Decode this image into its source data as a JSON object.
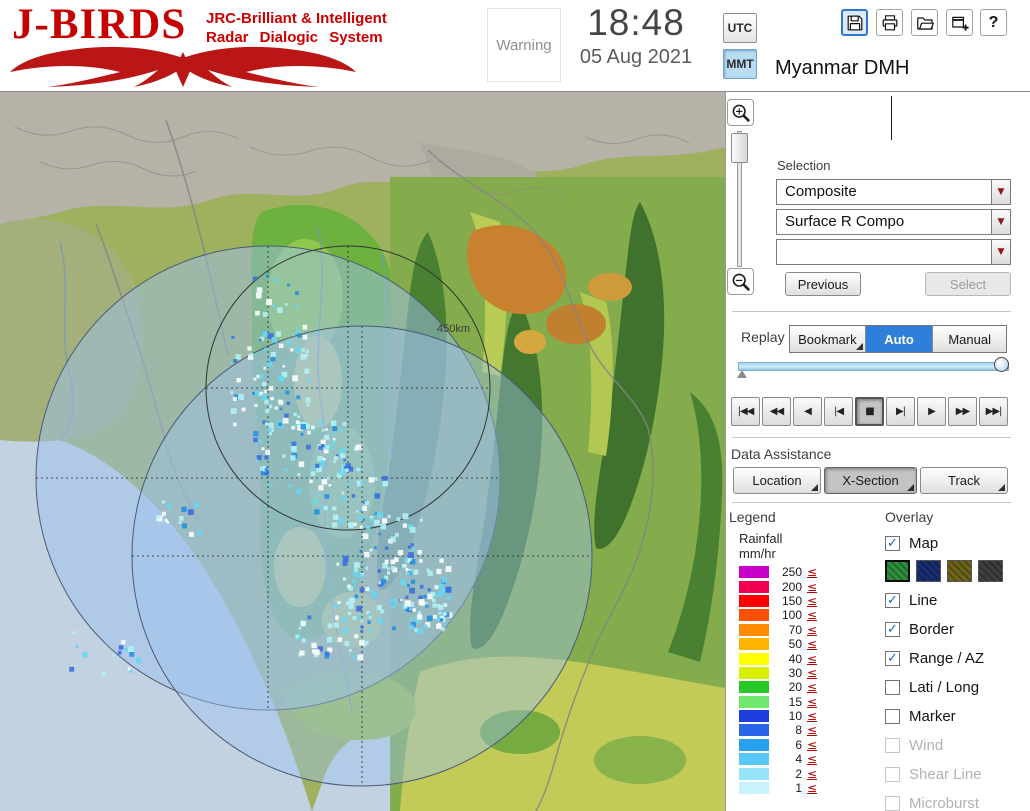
{
  "header": {
    "logo_title": "J-BIRDS",
    "logo_sub1": "JRC-Brilliant & Intelligent",
    "logo_sub2": "Radar Dialogic System",
    "warning": "Warning",
    "time": "18:48",
    "date": "05 Aug 2021",
    "tz_utc": "UTC",
    "tz_mmt": "MMT",
    "tz_selected": "MMT",
    "help_glyph": "?",
    "station": "Myanmar DMH",
    "toolbar_icons": [
      "save",
      "print",
      "open",
      "new-window",
      "help"
    ]
  },
  "map": {
    "range_label": "450km",
    "zoom_in": "+",
    "zoom_out": "−"
  },
  "selection": {
    "label": "Selection",
    "dropdowns": [
      "Composite",
      "Surface R Compo",
      ""
    ],
    "arrow_glyph": "▼",
    "previous_button": "Previous",
    "select_button": "Select",
    "select_disabled": true
  },
  "replay": {
    "label": "Replay",
    "bookmark": "Bookmark",
    "auto": "Auto",
    "manual": "Manual",
    "selected_mode": "Auto",
    "playback": [
      "|◀◀",
      "◀◀",
      "◀",
      "|◀",
      "■",
      "▶|",
      "▶",
      "▶▶",
      "▶▶|"
    ],
    "pressed_button": "■"
  },
  "data_assistance": {
    "label": "Data Assistance",
    "buttons": [
      "Location",
      "X-Section",
      "Track"
    ],
    "pressed_button": "X-Section"
  },
  "legend": {
    "label": "Legend",
    "unit_line1": "Rainfall",
    "unit_line2": "mm/hr",
    "le_glyph": "≤",
    "rows": [
      {
        "value": "250",
        "color": "#c800c8"
      },
      {
        "value": "200",
        "color": "#f00050"
      },
      {
        "value": "150",
        "color": "#ff0000"
      },
      {
        "value": "100",
        "color": "#ff5000"
      },
      {
        "value": "70",
        "color": "#ff8c00"
      },
      {
        "value": "50",
        "color": "#ffb400"
      },
      {
        "value": "40",
        "color": "#ffff00"
      },
      {
        "value": "30",
        "color": "#d8f000"
      },
      {
        "value": "20",
        "color": "#28c828"
      },
      {
        "value": "15",
        "color": "#70e870"
      },
      {
        "value": "10",
        "color": "#1e3cdc"
      },
      {
        "value": "8",
        "color": "#2864e8"
      },
      {
        "value": "6",
        "color": "#28a0f0"
      },
      {
        "value": "4",
        "color": "#58c8f8"
      },
      {
        "value": "2",
        "color": "#96e4fa"
      },
      {
        "value": "1",
        "color": "#c8f2fc"
      }
    ]
  },
  "overlay": {
    "label": "Overlay",
    "check_glyph": "✓",
    "items": [
      {
        "label": "Map",
        "checked": true,
        "disabled": false
      },
      {
        "label": "Line",
        "checked": true,
        "disabled": false
      },
      {
        "label": "Border",
        "checked": true,
        "disabled": false
      },
      {
        "label": "Range / AZ",
        "checked": true,
        "disabled": false
      },
      {
        "label": "Lati / Long",
        "checked": false,
        "disabled": false
      },
      {
        "label": "Marker",
        "checked": false,
        "disabled": false
      },
      {
        "label": "Wind",
        "checked": false,
        "disabled": true
      },
      {
        "label": "Shear Line",
        "checked": false,
        "disabled": true
      },
      {
        "label": "Microburst",
        "checked": false,
        "disabled": true
      }
    ],
    "map_swatches": [
      "#2f8f3c",
      "#1a2f73",
      "#6f6519",
      "#3f3f3f"
    ]
  },
  "colors": {
    "logo_red": "#c40000",
    "active_mode_blue": "#2e7fd9",
    "timezone_selected_blue": "#b9dcf3",
    "timeline_blue": "#9fd4ec"
  }
}
